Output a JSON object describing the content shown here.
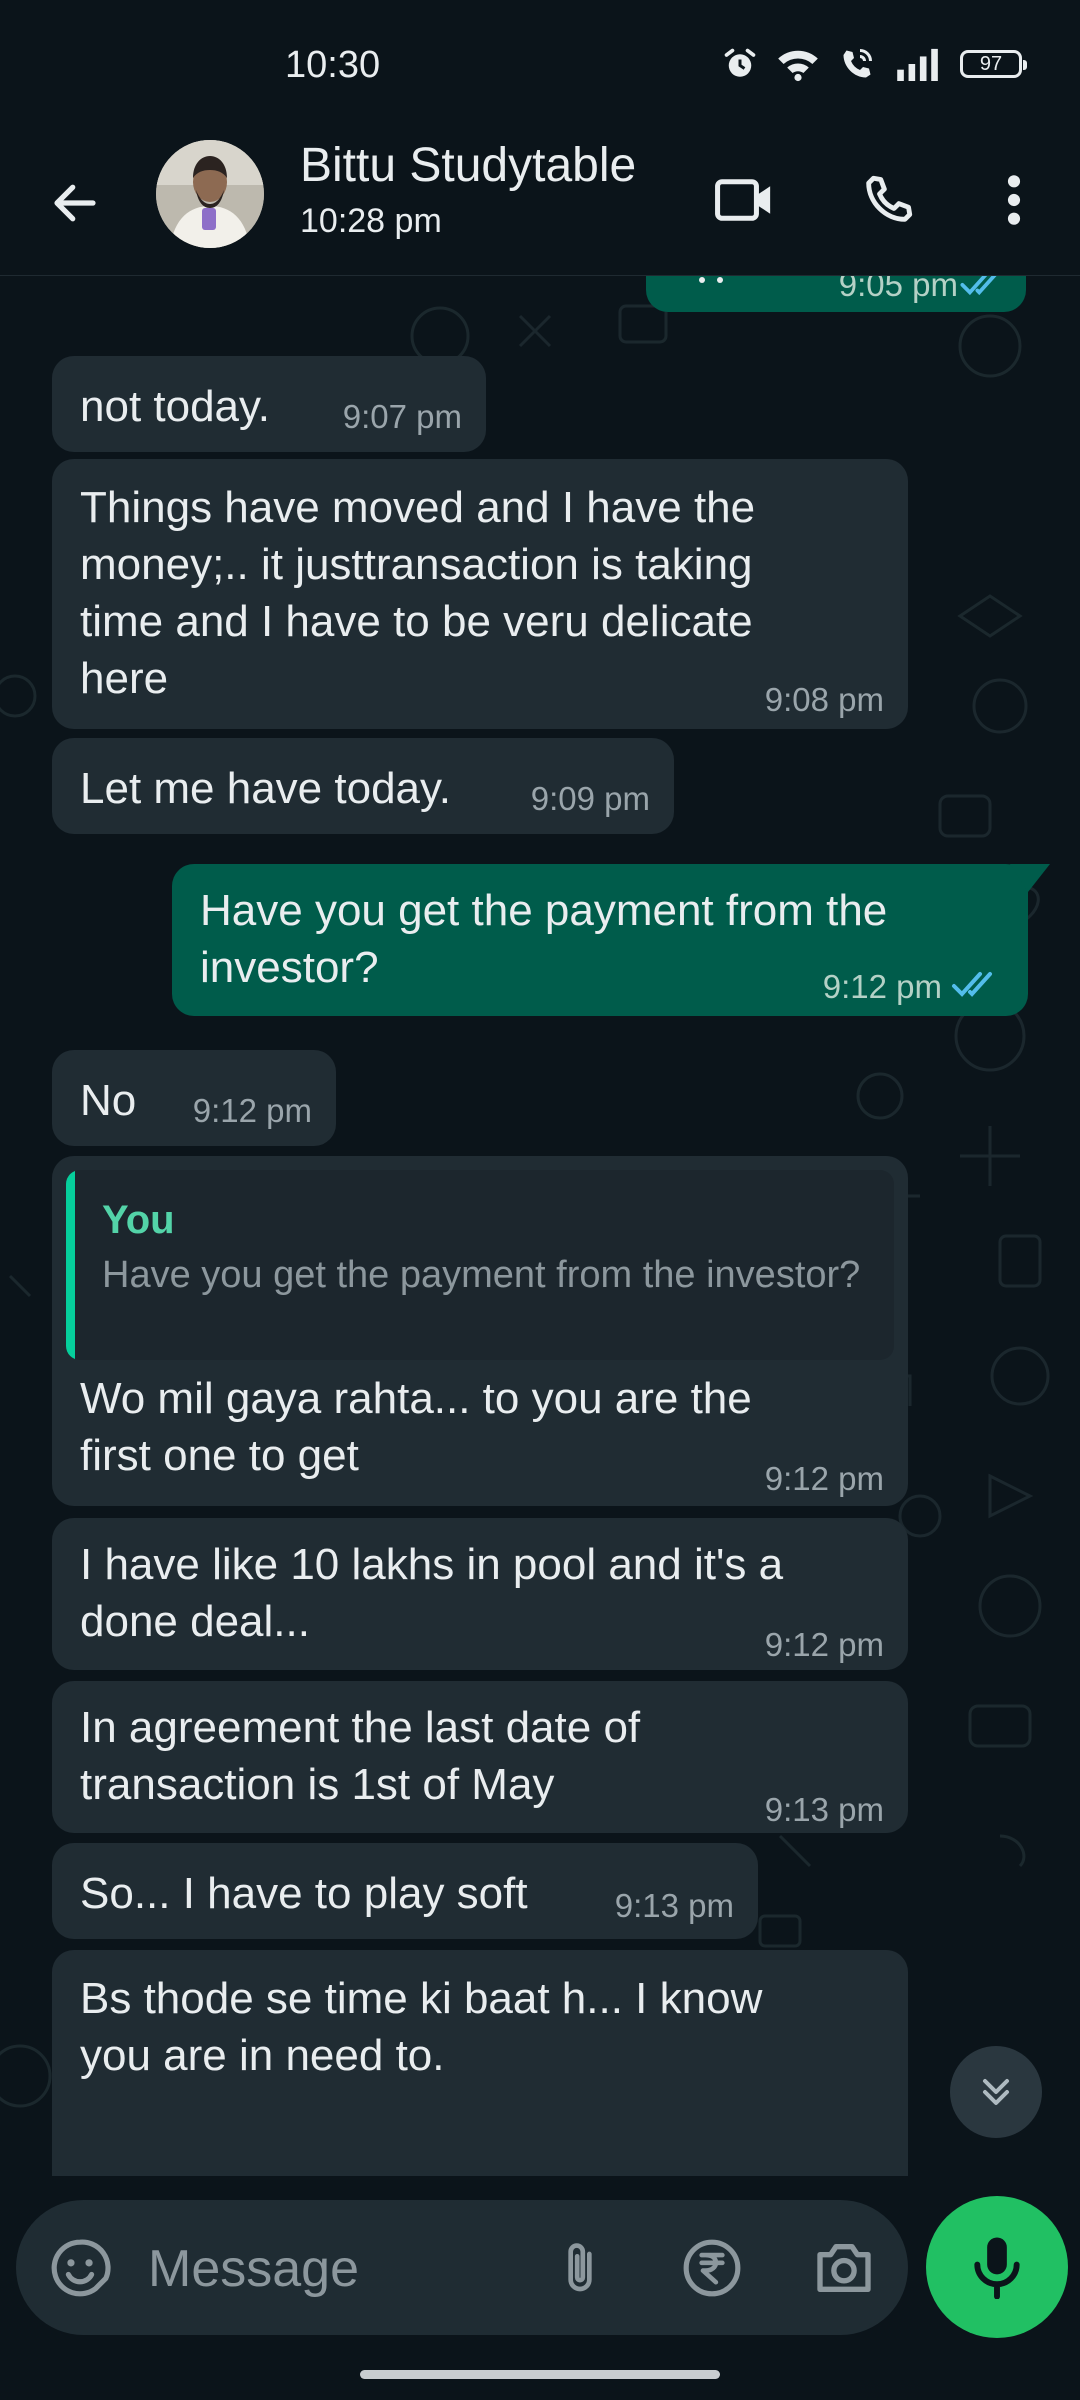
{
  "status_bar": {
    "time": "10:30",
    "battery": "97"
  },
  "header": {
    "name": "Bittu Studytable",
    "last_seen": "10:28 pm"
  },
  "messages": [
    {
      "dir": "out",
      "text": "",
      "time": "9:05 pm"
    },
    {
      "dir": "in",
      "text": "not today.",
      "time": "9:07 pm"
    },
    {
      "dir": "in",
      "text": "Things have moved and I have the\nmoney;.. it justtransaction is taking\ntime and I have to be veru delicate\nhere",
      "time": "9:08 pm"
    },
    {
      "dir": "in",
      "text": "Let me have today.",
      "time": "9:09 pm"
    },
    {
      "dir": "out",
      "text": "Have you get the payment from the\ninvestor?",
      "time": "9:12 pm"
    },
    {
      "dir": "in",
      "text": "No",
      "time": "9:12 pm"
    },
    {
      "dir": "in",
      "text": "Wo mil gaya rahta... to you are the\nfirst one to get",
      "time": "9:12 pm",
      "quote": {
        "author": "You",
        "text": "Have you get the payment from the investor?"
      }
    },
    {
      "dir": "in",
      "text": "I have like 10 lakhs in pool and it's a\ndone deal...",
      "time": "9:12 pm"
    },
    {
      "dir": "in",
      "text": "In agreement the last date of\ntransaction is 1st of May",
      "time": "9:13 pm"
    },
    {
      "dir": "in",
      "text": "So... I have to play soft",
      "time": "9:13 pm"
    },
    {
      "dir": "in",
      "text": "Bs thode se time ki baat h... I know\nyou are in need to.",
      "time": ""
    }
  ],
  "composer": {
    "placeholder": "Message"
  },
  "colors": {
    "accent": "#21c063",
    "incoming": "#202c33",
    "outgoing": "#005c4b",
    "tick": "#53bdeb"
  }
}
